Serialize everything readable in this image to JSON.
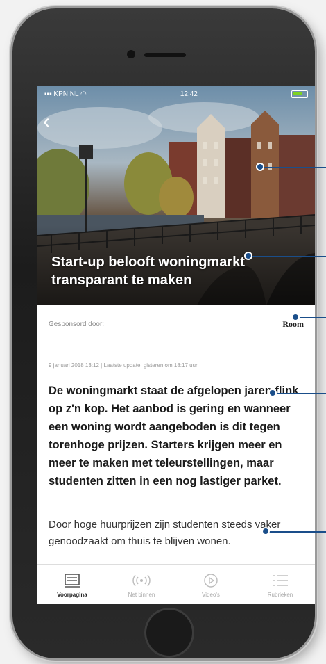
{
  "statusbar": {
    "carrier": "KPN NL",
    "time": "12:42"
  },
  "article": {
    "title": "Start-up belooft woningmarkt transparant te maken",
    "sponsor_label": "Gesponsord door:",
    "sponsor_logo": "Room",
    "dateline": "9 januari 2018 13:12 | Laatste update: gisteren om 18:17 uur",
    "lead": "De woningmarkt staat de afgelopen jaren flink op z'n kop. Het aanbod is gering en wanneer een woning wordt aangeboden is dit tegen torenhoge prijzen. Starters krijgen meer en meer te maken met teleurstellingen, maar studenten zitten in een nog lastiger parket.",
    "body": "Door hoge huurprijzen zijn studenten steeds vaker genoodzaakt om thuis te blijven wonen."
  },
  "tabs": [
    {
      "label": "Voorpagina",
      "icon": "newspaper-icon",
      "active": true
    },
    {
      "label": "Net binnen",
      "icon": "broadcast-icon",
      "active": false
    },
    {
      "label": "Video's",
      "icon": "play-icon",
      "active": false
    },
    {
      "label": "Rubrieken",
      "icon": "list-icon",
      "active": false
    }
  ],
  "colors": {
    "callout": "#1a4e8a",
    "battery": "#7ed321"
  }
}
